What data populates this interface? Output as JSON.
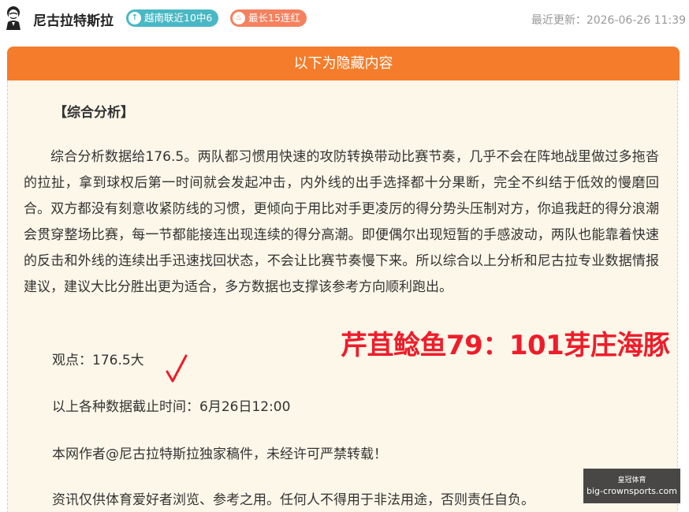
{
  "header": {
    "author": "尼古拉特斯拉",
    "badge_streak_record": "越南联近10中6",
    "badge_longest": "最长15连红",
    "update_label": "最近更新：2026-06-26 11:39"
  },
  "panel": {
    "title": "以下为隐藏内容",
    "section_title": "【综合分析】",
    "paragraph": "综合分析数据给176.5。两队都习惯用快速的攻防转换带动比赛节奏，几乎不会在阵地战里做过多拖沓的拉扯，拿到球权后第一时间就会发起冲击，内外线的出手选择都十分果断，完全不纠结于低效的慢磨回合。双方都没有刻意收紧防线的习惯，更倾向于用比对手更凌厉的得分势头压制对方，你追我赶的得分浪潮会贯穿整场比赛，每一节都能接连出现连续的得分高潮。即便偶尔出现短暂的手感波动，两队也能靠着快速的反击和外线的连续出手迅速找回状态，不会让比赛节奏慢下来。所以综合以上分析和尼古拉专业数据情报建议，建议大比分胜出更为适合，多方数据也支撑该参考方向顺利跑出。",
    "view": "观点：176.5大",
    "cutoff": "以上各种数据截止时间：6月26日12:00",
    "copyright": "本网作者@尼古拉特斯拉独家稿件，未经许可严禁转载！",
    "disclaimer": "资讯仅供体育爱好者浏览、参考之用。任何人不得用于非法用途，否则责任自负。",
    "score_overlay": "芹苴鲶鱼79：101芽庄海豚"
  },
  "watermark": {
    "top": "皇冠体育",
    "bottom": "big-crownsports.com"
  },
  "colors": {
    "panel_header": "#f47c2b",
    "panel_bg": "#fdf7e9",
    "badge_teal": "#49b8c4",
    "badge_orange": "#f5815f",
    "score_red": "#ef1c2a"
  },
  "icons": {
    "avatar": "portrait-avatar",
    "badge_a": "arrow-up-icon",
    "badge_b": "flame-icon",
    "check": "check-mark-icon"
  }
}
